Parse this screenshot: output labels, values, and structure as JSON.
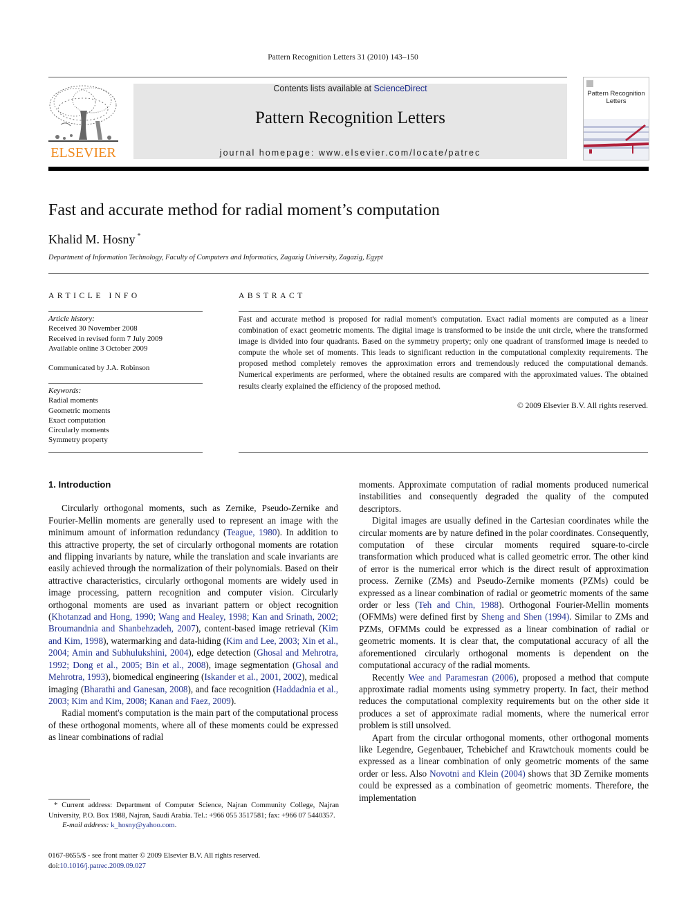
{
  "running_head": "Pattern Recognition Letters 31 (2010) 143–150",
  "publisher": {
    "logo_word": "ELSEVIER",
    "logo_color": "#f08a1e"
  },
  "banner": {
    "contents_prefix": "Contents lists available at ",
    "contents_link": "ScienceDirect",
    "journal_title": "Pattern Recognition Letters",
    "homepage": "journal homepage: www.elsevier.com/locate/patrec"
  },
  "cover": {
    "title_line1": "Pattern Recognition",
    "title_line2": "Letters"
  },
  "article": {
    "title": "Fast and accurate method for radial moment’s computation",
    "author": "Khalid M. Hosny",
    "author_mark": "*",
    "affiliation": "Department of Information Technology, Faculty of Computers and Informatics, Zagazig University, Zagazig, Egypt"
  },
  "article_info": {
    "heading": "ARTICLE INFO",
    "history_label": "Article history:",
    "history": [
      "Received 30 November 2008",
      "Received in revised form 7 July 2009",
      "Available online 3 October 2009"
    ],
    "communicated": "Communicated by J.A. Robinson",
    "keywords_label": "Keywords:",
    "keywords": [
      "Radial moments",
      "Geometric moments",
      "Exact computation",
      "Circularly moments",
      "Symmetry property"
    ]
  },
  "abstract": {
    "heading": "ABSTRACT",
    "text": "Fast and accurate method is proposed for radial moment's computation. Exact radial moments are computed as a linear combination of exact geometric moments. The digital image is transformed to be inside the unit circle, where the transformed image is divided into four quadrants. Based on the symmetry property; only one quadrant of transformed image is needed to compute the whole set of moments. This leads to significant reduction in the computational complexity requirements. The proposed method completely removes the approximation errors and tremendously reduced the computational demands. Numerical experiments are performed, where the obtained results are compared with the approximated values. The obtained results clearly explained the efficiency of the proposed method.",
    "copyright": "© 2009 Elsevier B.V. All rights reserved."
  },
  "body": {
    "section_heading": "1. Introduction",
    "p1": [
      {
        "t": "Circularly orthogonal moments, such as Zernike, Pseudo-Zernike and Fourier-Mellin moments are generally used to represent an image with the minimum amount of information redundancy ("
      },
      {
        "t": "Teague, 1980",
        "link": true
      },
      {
        "t": "). In addition to this attractive property, the set of circularly orthogonal moments are rotation and flipping invariants by nature, while the translation and scale invariants are easily achieved through the normalization of their polynomials. Based on their attractive characteristics, circularly orthogonal moments are widely used in image processing, pattern recognition and computer vision. Circularly orthogonal moments are used as invariant pattern or object recognition ("
      },
      {
        "t": "Khotanzad and Hong, 1990; Wang and Healey, 1998; Kan and Srinath, 2002; Broumandnia and Shanbehzadeh, 2007",
        "link": true
      },
      {
        "t": "), content-based image retrieval ("
      },
      {
        "t": "Kim and Kim, 1998",
        "link": true
      },
      {
        "t": "), watermarking and data-hiding ("
      },
      {
        "t": "Kim and Lee, 2003; Xin et al., 2004; Amin and Subhulukshini, 2004",
        "link": true
      },
      {
        "t": "), edge detection ("
      },
      {
        "t": "Ghosal and Mehrotra, 1992; Dong et al., 2005; Bin et al., 2008",
        "link": true
      },
      {
        "t": "), image segmentation ("
      },
      {
        "t": "Ghosal and Mehrotra, 1993",
        "link": true
      },
      {
        "t": "), biomedical engineering ("
      },
      {
        "t": "Iskander et al., 2001, 2002",
        "link": true
      },
      {
        "t": "), medical imaging ("
      },
      {
        "t": "Bharathi and Ganesan, 2008",
        "link": true
      },
      {
        "t": "), and face recognition ("
      },
      {
        "t": "Haddadnia et al., 2003; Kim and Kim, 2008; Kanan and Faez, 2009",
        "link": true
      },
      {
        "t": ")."
      }
    ],
    "p2": [
      {
        "t": "Radial moment's computation is the main part of the computational process of these orthogonal moments, where all of these moments could be expressed as linear combinations of radial moments. Approximate computation of radial moments produced numerical instabilities and consequently degraded the quality of the computed descriptors."
      }
    ],
    "p3": [
      {
        "t": "Digital images are usually defined in the Cartesian coordinates while the circular moments are by nature defined in the polar coordinates. Consequently, computation of these circular moments required square-to-circle transformation which produced what is called geometric error. The other kind of error is the numerical error which is the direct result of approximation process. Zernike (ZMs) and Pseudo-Zernike moments (PZMs) could be expressed as a linear combination of radial or geometric moments of the same order or less ("
      },
      {
        "t": "Teh and Chin, 1988",
        "link": true
      },
      {
        "t": "). Orthogonal Fourier-Mellin moments (OFMMs) were defined first by "
      },
      {
        "t": "Sheng and Shen (1994)",
        "link": true
      },
      {
        "t": ". Similar to ZMs and PZMs, OFMMs could be expressed as a linear combination of radial or geometric moments. It is clear that, the computational accuracy of all the aforementioned circularly orthogonal moments is dependent on the computational accuracy of the radial moments."
      }
    ],
    "p4": [
      {
        "t": "Recently "
      },
      {
        "t": "Wee and Paramesran (2006)",
        "link": true
      },
      {
        "t": ", proposed a method that compute approximate radial moments using symmetry property. In fact, their method reduces the computational complexity requirements but on the other side it produces a set of approximate radial moments, where the numerical error problem is still unsolved."
      }
    ],
    "p5": [
      {
        "t": "Apart from the circular orthogonal moments, other orthogonal moments like Legendre, Gegenbauer, Tchebichef and Krawtchouk moments could be expressed as a linear combination of only geometric moments of the same order or less. Also "
      },
      {
        "t": "Novotni and Klein (2004)",
        "link": true
      },
      {
        "t": " shows that 3D Zernike moments could be expressed as a combination of geometric moments. Therefore, the implementation"
      }
    ]
  },
  "footnote": {
    "mark": "*",
    "text": "Current address: Department of Computer Science, Najran Community College, Najran University, P.O. Box 1988, Najran, Saudi Arabia. Tel.: +966 055 3517581; fax: +966 07 5440357.",
    "email_label": "E-mail address: ",
    "email": "k_hosny@yahoo.com",
    "email_suffix": "."
  },
  "front_matter": {
    "issn_line": "0167-8655/$ - see front matter © 2009 Elsevier B.V. All rights reserved.",
    "doi_label": "doi:",
    "doi": "10.1016/j.patrec.2009.09.027"
  },
  "colors": {
    "link": "#1f2f8f",
    "banner_bg": "#e6e6e6",
    "elsevier_orange": "#f08a1e"
  }
}
